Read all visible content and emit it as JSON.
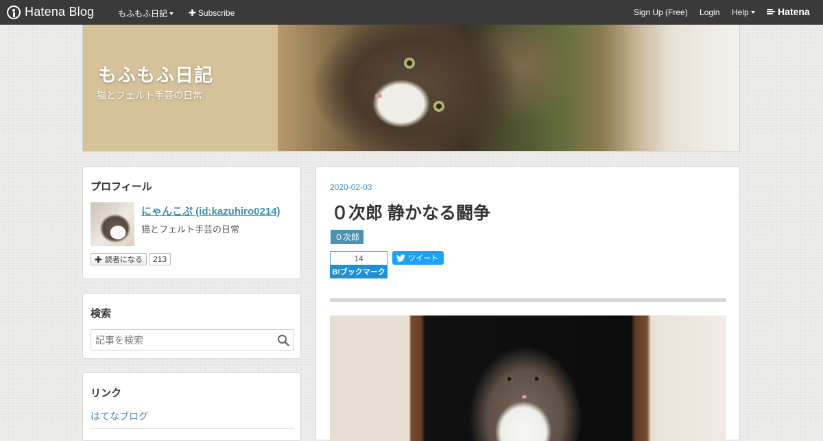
{
  "topbar": {
    "brand": "Hatena Blog",
    "blog_menu": "もふもふ日記",
    "subscribe": "Subscribe",
    "signup": "Sign Up (Free)",
    "login": "Login",
    "help": "Help",
    "hatena_logo": "Hatena"
  },
  "header": {
    "title": "もふもふ日記",
    "description": "猫とフェルト手芸の日常"
  },
  "sidebar": {
    "profile": {
      "title": "プロフィール",
      "name": "にゃんこぷ (id:kazuhiro0214)",
      "description": "猫とフェルト手芸の日常",
      "reader_button": "読者になる",
      "reader_count": "213"
    },
    "search": {
      "title": "検索",
      "placeholder": "記事を検索"
    },
    "links": {
      "title": "リンク",
      "items": [
        "はてなブログ"
      ]
    }
  },
  "article": {
    "date": "2020-02-03",
    "title": "０次郎 静かなる闘争",
    "category": "０次郎",
    "bookmark_count": "14",
    "bookmark_label": "B!ブックマーク",
    "tweet_label": "ツイート"
  },
  "colors": {
    "topbar_bg": "#3a3a3a",
    "link": "#3a8fb0",
    "category_bg": "#4a93b3",
    "bookmark_blue": "#1f8fd6",
    "twitter_blue": "#1da1f2"
  },
  "icons": [
    "hatena-logo-icon",
    "plus-icon",
    "caret-down-icon",
    "hatena-waves-icon",
    "search-icon",
    "twitter-bird-icon"
  ]
}
